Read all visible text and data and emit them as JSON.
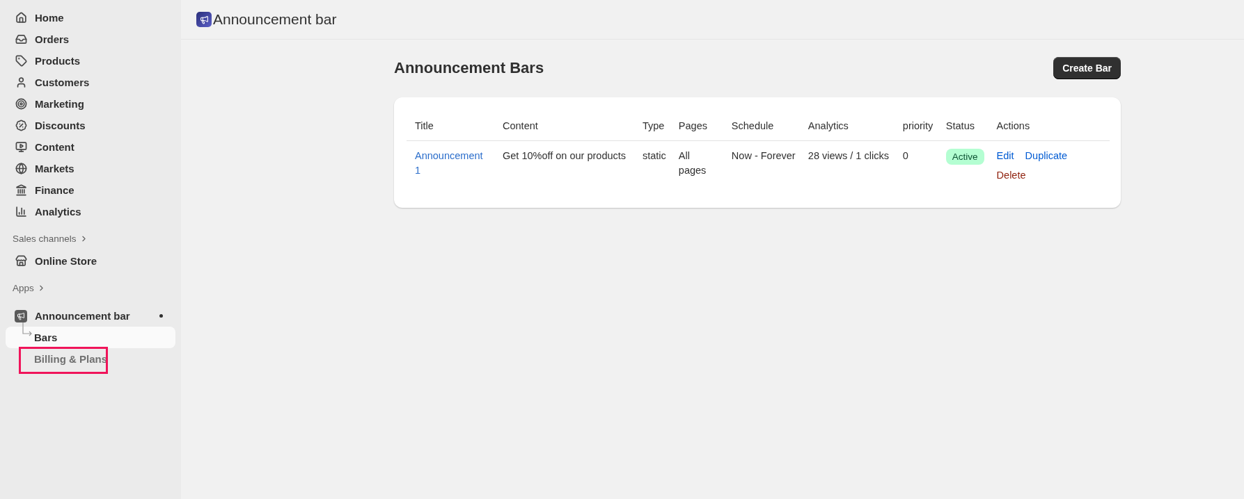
{
  "sidebar": {
    "items": [
      {
        "label": "Home",
        "selected": false
      },
      {
        "label": "Orders",
        "selected": false
      },
      {
        "label": "Products",
        "selected": false
      },
      {
        "label": "Customers",
        "selected": false
      },
      {
        "label": "Marketing",
        "selected": false
      },
      {
        "label": "Discounts",
        "selected": false
      },
      {
        "label": "Content",
        "selected": false
      },
      {
        "label": "Markets",
        "selected": false
      },
      {
        "label": "Finance",
        "selected": false
      },
      {
        "label": "Analytics",
        "selected": false
      }
    ],
    "sales_channels": {
      "heading": "Sales channels",
      "items": [
        {
          "label": "Online Store",
          "selected": false
        }
      ]
    },
    "apps": {
      "heading": "Apps",
      "items": [
        {
          "label": "Announcement bar",
          "selected": false,
          "children": [
            {
              "label": "Bars",
              "selected": true,
              "highlighted": false
            },
            {
              "label": "Billing & Plans",
              "selected": false,
              "highlighted": true
            }
          ]
        }
      ]
    }
  },
  "header": {
    "title": "Announcement bar"
  },
  "page": {
    "title": "Announcement Bars",
    "primary_button": "Create Bar"
  },
  "table": {
    "columns": [
      "Title",
      "Content",
      "Type",
      "Pages",
      "Schedule",
      "Analytics",
      "priority",
      "Status",
      "Actions"
    ],
    "rows": [
      {
        "cells": [
          {
            "kind": "link",
            "text": "Announcement 1"
          },
          {
            "kind": "text",
            "text": "Get 10%off on our products"
          },
          {
            "kind": "text",
            "text": "static"
          },
          {
            "kind": "text",
            "text": "All pages"
          },
          {
            "kind": "text",
            "text": "Now - Forever"
          },
          {
            "kind": "text",
            "text": "28 views / 1 clicks"
          },
          {
            "kind": "text",
            "text": "0"
          },
          {
            "kind": "badge",
            "text": "Active"
          },
          {
            "kind": "actions",
            "actions": [
              {
                "label": "Edit",
                "kind": "link"
              },
              {
                "label": "Duplicate",
                "kind": "link"
              },
              {
                "label": "Delete",
                "kind": "danger"
              }
            ]
          }
        ]
      }
    ]
  }
}
